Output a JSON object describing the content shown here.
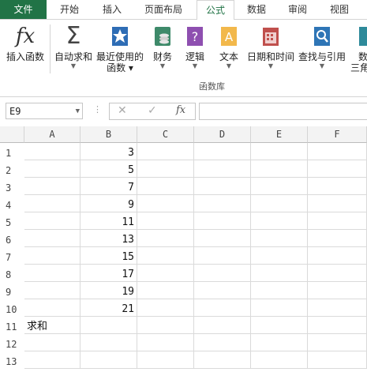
{
  "tabs": [
    "文件",
    "开始",
    "插入",
    "页面布局",
    "公式",
    "数据",
    "审阅",
    "视图"
  ],
  "active_tab": "公式",
  "ribbon": {
    "insert_function": "插入函数",
    "autosum": "自动求和",
    "recent_line1": "最近使用的",
    "recent_line2": "函数",
    "financial": "财务",
    "logical": "逻辑",
    "text": "文本",
    "datetime": "日期和时间",
    "lookup": "查找与引用",
    "more_line1": "数",
    "more_line2": "三角",
    "group_label": "函数库",
    "fx_glyph": "fx",
    "sigma_glyph": "Σ"
  },
  "formula_bar": {
    "name_box": "E9",
    "cancel": "✕",
    "enter": "✓",
    "fx": "fx",
    "value": ""
  },
  "columns": [
    "A",
    "B",
    "C",
    "D",
    "E",
    "F"
  ],
  "rows": [
    {
      "n": "1",
      "a": "",
      "b": "3"
    },
    {
      "n": "2",
      "a": "",
      "b": "5"
    },
    {
      "n": "3",
      "a": "",
      "b": "7"
    },
    {
      "n": "4",
      "a": "",
      "b": "9"
    },
    {
      "n": "5",
      "a": "",
      "b": "11"
    },
    {
      "n": "6",
      "a": "",
      "b": "13"
    },
    {
      "n": "7",
      "a": "",
      "b": "15"
    },
    {
      "n": "8",
      "a": "",
      "b": "17"
    },
    {
      "n": "9",
      "a": "",
      "b": "19"
    },
    {
      "n": "10",
      "a": "",
      "b": "21"
    },
    {
      "n": "11",
      "a": "求和",
      "b": ""
    },
    {
      "n": "12",
      "a": "",
      "b": ""
    },
    {
      "n": "13",
      "a": "",
      "b": ""
    }
  ],
  "colors": {
    "accent": "#217346"
  }
}
